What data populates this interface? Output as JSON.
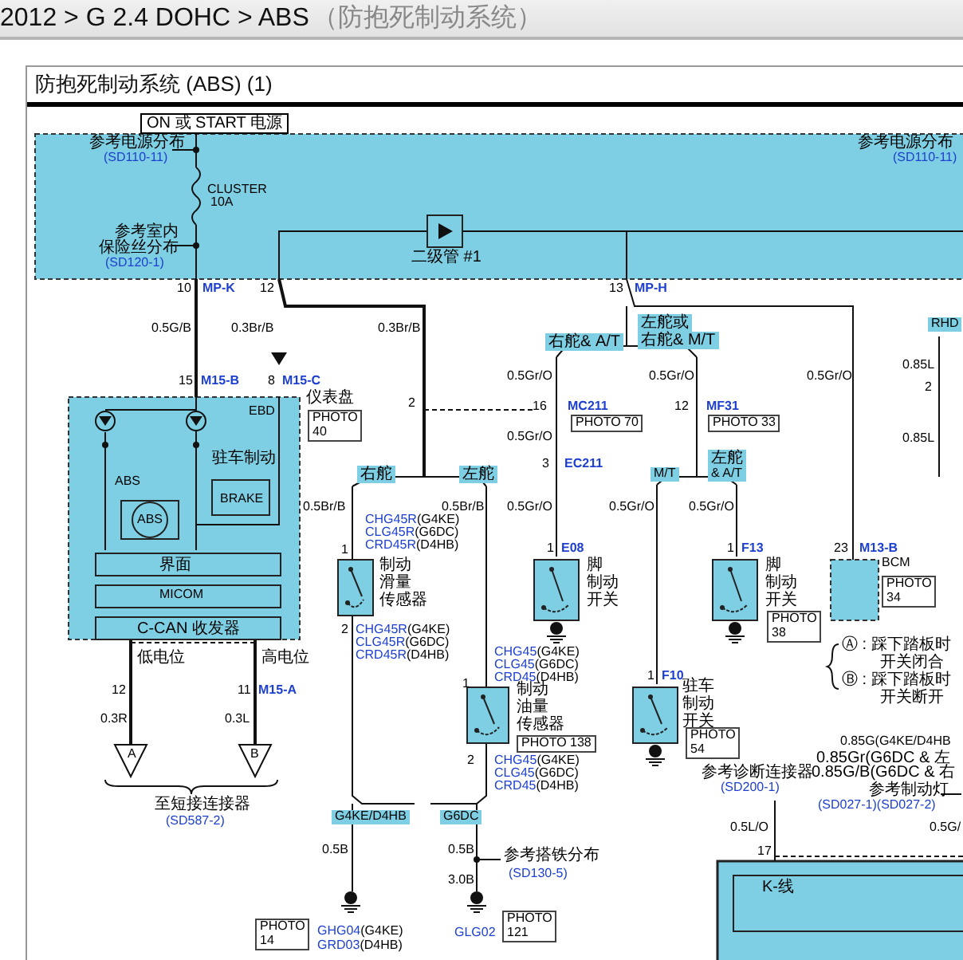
{
  "breadcrumb": {
    "path": "2012 > G 2.4 DOHC > ABS",
    "section": "（防抱死制动系统）"
  },
  "diagram": {
    "title": "防抱死制动系统 (ABS) (1)",
    "labels": [
      {
        "kind": "power",
        "text": "ON 或 START 电源"
      },
      {
        "kind": "plain",
        "text": "参考电源分布"
      },
      {
        "kind": "ref",
        "text": "(SD110-11)"
      },
      {
        "kind": "plain",
        "text": "CLUSTER"
      },
      {
        "kind": "plain",
        "text": "10A"
      },
      {
        "kind": "plain",
        "text": "参考室内"
      },
      {
        "kind": "plain",
        "text": "保险丝分布"
      },
      {
        "kind": "ref",
        "text": "(SD120-1)"
      },
      {
        "kind": "plain",
        "text": "二级管 #1"
      },
      {
        "kind": "plain",
        "text": "参考电源分布"
      },
      {
        "kind": "ref",
        "text": "(SD110-11)"
      },
      {
        "kind": "pin",
        "text": "10"
      },
      {
        "kind": "connector",
        "text": "MP-K"
      },
      {
        "kind": "pin",
        "text": "12"
      },
      {
        "kind": "pin",
        "text": "13"
      },
      {
        "kind": "connector",
        "text": "MP-H"
      },
      {
        "kind": "wire",
        "text": "0.5G/B"
      },
      {
        "kind": "wire",
        "text": "0.3Br/B"
      },
      {
        "kind": "wire",
        "text": "0.3Br/B"
      },
      {
        "kind": "pin",
        "text": "15"
      },
      {
        "kind": "connector",
        "text": "M15-B"
      },
      {
        "kind": "pin",
        "text": "8"
      },
      {
        "kind": "connector",
        "text": "M15-C"
      },
      {
        "kind": "plain",
        "text": "仪表盘"
      },
      {
        "kind": "photo",
        "text": "PHOTO\n40"
      },
      {
        "kind": "plain",
        "text": "EBD"
      },
      {
        "kind": "plain",
        "text": "驻车制动"
      },
      {
        "kind": "plain",
        "text": "ABS"
      },
      {
        "kind": "plain",
        "text": "ABS"
      },
      {
        "kind": "plain",
        "text": "BRAKE"
      },
      {
        "kind": "plain",
        "text": "界面"
      },
      {
        "kind": "plain",
        "text": "MICOM"
      },
      {
        "kind": "plain",
        "text": "C-CAN 收发器"
      },
      {
        "kind": "plain",
        "text": "低电位"
      },
      {
        "kind": "plain",
        "text": "高电位"
      },
      {
        "kind": "pin",
        "text": "12"
      },
      {
        "kind": "pin",
        "text": "11"
      },
      {
        "kind": "connector",
        "text": "M15-A"
      },
      {
        "kind": "wire",
        "text": "0.3R"
      },
      {
        "kind": "wire",
        "text": "0.3L"
      },
      {
        "kind": "plain",
        "text": "A"
      },
      {
        "kind": "plain",
        "text": "B"
      },
      {
        "kind": "plain",
        "text": "至短接连接器"
      },
      {
        "kind": "ref",
        "text": "(SD587-2)"
      },
      {
        "kind": "pin",
        "text": "2"
      },
      {
        "kind": "tag",
        "text": "右舵"
      },
      {
        "kind": "tag",
        "text": "左舵"
      },
      {
        "kind": "wire",
        "text": "0.5Br/B"
      },
      {
        "kind": "wire",
        "text": "0.5Br/B"
      },
      {
        "kind": "pin",
        "text": "1"
      },
      {
        "kind": "code",
        "text": "CHG45R",
        "variant": "(G4KE)"
      },
      {
        "kind": "code",
        "text": "CLG45R",
        "variant": "(G6DC)"
      },
      {
        "kind": "code",
        "text": "CRD45R",
        "variant": "(D4HB)"
      },
      {
        "kind": "plain",
        "text": "制动"
      },
      {
        "kind": "plain",
        "text": "滑量"
      },
      {
        "kind": "plain",
        "text": "传感器"
      },
      {
        "kind": "pin",
        "text": "2"
      },
      {
        "kind": "code",
        "text": "CHG45R",
        "variant": "(G4KE)"
      },
      {
        "kind": "code",
        "text": "CLG45R",
        "variant": "(G6DC)"
      },
      {
        "kind": "code",
        "text": "CRD45R",
        "variant": "(D4HB)"
      },
      {
        "kind": "pin",
        "text": "1"
      },
      {
        "kind": "code",
        "text": "CHG45",
        "variant": "(G4KE)"
      },
      {
        "kind": "code",
        "text": "CLG45",
        "variant": "(G6DC)"
      },
      {
        "kind": "code",
        "text": "CRD45",
        "variant": "(D4HB)"
      },
      {
        "kind": "plain",
        "text": "制动"
      },
      {
        "kind": "plain",
        "text": "油量"
      },
      {
        "kind": "plain",
        "text": "传感器"
      },
      {
        "kind": "photo",
        "text": "PHOTO 138"
      },
      {
        "kind": "pin",
        "text": "2"
      },
      {
        "kind": "code",
        "text": "CHG45",
        "variant": "(G4KE)"
      },
      {
        "kind": "code",
        "text": "CLG45",
        "variant": "(G6DC)"
      },
      {
        "kind": "code",
        "text": "CRD45",
        "variant": "(D4HB)"
      },
      {
        "kind": "tag",
        "text": "G4KE/D4HB"
      },
      {
        "kind": "tag",
        "text": "G6DC"
      },
      {
        "kind": "wire",
        "text": "0.5B"
      },
      {
        "kind": "wire",
        "text": "0.5B"
      },
      {
        "kind": "wire",
        "text": "3.0B"
      },
      {
        "kind": "plain",
        "text": "参考搭铁分布"
      },
      {
        "kind": "ref",
        "text": "(SD130-5)"
      },
      {
        "kind": "photo",
        "text": "PHOTO\n14"
      },
      {
        "kind": "code",
        "text": "GHG04",
        "variant": "(G4KE)"
      },
      {
        "kind": "code",
        "text": "GRD03",
        "variant": "(D4HB)"
      },
      {
        "kind": "code",
        "text": "GLG02"
      },
      {
        "kind": "photo",
        "text": "PHOTO\n121"
      },
      {
        "kind": "tag",
        "text": "右舵& A/T"
      },
      {
        "kind": "tag",
        "text": "左舵或"
      },
      {
        "kind": "tag",
        "text": "右舵& M/T"
      },
      {
        "kind": "wire",
        "text": "0.5Gr/O"
      },
      {
        "kind": "wire",
        "text": "0.5Gr/O"
      },
      {
        "kind": "wire",
        "text": "0.5Gr/O"
      },
      {
        "kind": "pin",
        "text": "16"
      },
      {
        "kind": "connector",
        "text": "MC211"
      },
      {
        "kind": "photo",
        "text": "PHOTO 70"
      },
      {
        "kind": "pin",
        "text": "12"
      },
      {
        "kind": "connector",
        "text": "MF31"
      },
      {
        "kind": "photo",
        "text": "PHOTO 33"
      },
      {
        "kind": "wire",
        "text": "0.5Gr/O"
      },
      {
        "kind": "pin",
        "text": "3"
      },
      {
        "kind": "connector",
        "text": "EC211"
      },
      {
        "kind": "tag",
        "text": "M/T"
      },
      {
        "kind": "tag",
        "text": "左舵"
      },
      {
        "kind": "tag",
        "text": "& A/T"
      },
      {
        "kind": "wire",
        "text": "0.5Gr/O"
      },
      {
        "kind": "wire",
        "text": "0.5Gr/O"
      },
      {
        "kind": "wire",
        "text": "0.5Gr/O"
      },
      {
        "kind": "pin",
        "text": "1"
      },
      {
        "kind": "connector",
        "text": "E08"
      },
      {
        "kind": "plain",
        "text": "脚"
      },
      {
        "kind": "plain",
        "text": "制动"
      },
      {
        "kind": "plain",
        "text": "开关"
      },
      {
        "kind": "pin",
        "text": "1"
      },
      {
        "kind": "connector",
        "text": "F13"
      },
      {
        "kind": "plain",
        "text": "脚"
      },
      {
        "kind": "plain",
        "text": "制动"
      },
      {
        "kind": "plain",
        "text": "开关"
      },
      {
        "kind": "photo",
        "text": "PHOTO\n38"
      },
      {
        "kind": "pin",
        "text": "23"
      },
      {
        "kind": "connector",
        "text": "M13-B"
      },
      {
        "kind": "plain",
        "text": "BCM"
      },
      {
        "kind": "photo",
        "text": "PHOTO\n34"
      },
      {
        "kind": "pin",
        "text": "1"
      },
      {
        "kind": "connector",
        "text": "F10"
      },
      {
        "kind": "plain",
        "text": "驻车"
      },
      {
        "kind": "plain",
        "text": "制动"
      },
      {
        "kind": "plain",
        "text": "开关"
      },
      {
        "kind": "photo",
        "text": "PHOTO\n54"
      },
      {
        "kind": "plain",
        "text": "Ⓐ : 踩下踏板时"
      },
      {
        "kind": "plain",
        "text": "开关闭合"
      },
      {
        "kind": "plain",
        "text": "Ⓑ : 踩下踏板时"
      },
      {
        "kind": "plain",
        "text": "开关断开"
      },
      {
        "kind": "plain",
        "text": "参考诊断连接器"
      },
      {
        "kind": "ref",
        "text": "(SD200-1)"
      },
      {
        "kind": "wire",
        "text": "0.85G(G4KE/D4HB"
      },
      {
        "kind": "wire",
        "text": "0.85Gr(G6DC & 左"
      },
      {
        "kind": "wire",
        "text": "0.85G/B(G6DC & 右"
      },
      {
        "kind": "plain",
        "text": "参考制动灯"
      },
      {
        "kind": "ref",
        "text": "(SD027-1)(SD027-2)"
      },
      {
        "kind": "wire",
        "text": "0.5L/O"
      },
      {
        "kind": "wire",
        "text": "0.5G/"
      },
      {
        "kind": "pin",
        "text": "17"
      },
      {
        "kind": "plain",
        "text": "K-线"
      },
      {
        "kind": "tag",
        "text": "RHD"
      },
      {
        "kind": "wire",
        "text": "0.85L"
      },
      {
        "kind": "pin",
        "text": "2"
      },
      {
        "kind": "wire",
        "text": "0.85L"
      }
    ]
  }
}
